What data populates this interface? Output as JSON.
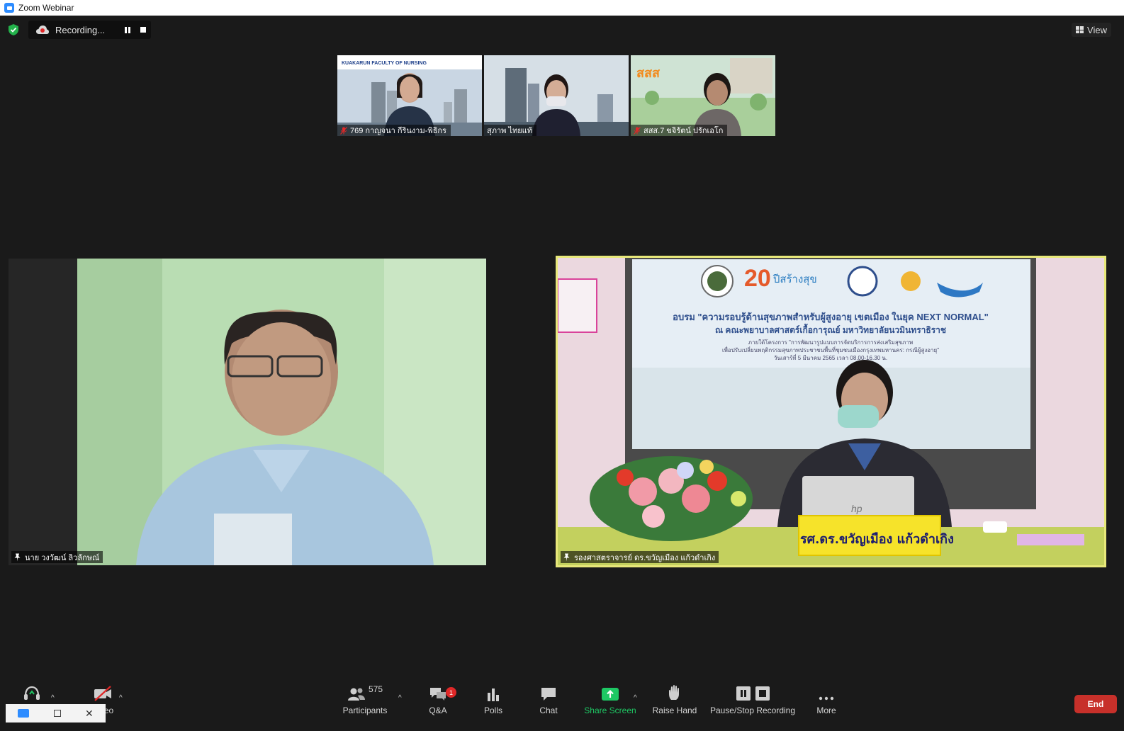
{
  "window": {
    "title": "Zoom Webinar"
  },
  "topbar": {
    "recording_text": "Recording...",
    "view_label": "View"
  },
  "thumbnails": [
    {
      "name": "769 กาญจนา กีรินงาม-พิธิกร",
      "muted": true,
      "banner": "KUAKARUN FACULTY OF NURSING"
    },
    {
      "name": "สุภาพ ไทยแท้",
      "muted": false
    },
    {
      "name": "สสส.7 ขจิรัตน์ ปรักเอโก",
      "muted": true,
      "banner": "สสส"
    }
  ],
  "main_videos": {
    "left": {
      "name": "นาย วงวัฒน์ ลิวลักษณ์"
    },
    "right": {
      "name": "รองศาสตราจารย์ ดร.ขวัญเมือง แก้วดำเกิง",
      "nameplate": "รศ.ดร.ขวัญเมือง  แก้วดำเกิง",
      "screen_title": "อบรม \"ความรอบรู้ด้านสุขภาพสำหรับผู้สูงอายุ เขตเมือง ในยุค NEXT NORMAL\"",
      "screen_subtitle": "ณ คณะพยาบาลศาสตร์เกื้อการุณย์ มหาวิทยาลัยนวมินทราธิราช",
      "screen_line1": "ภายใต้โครงการ \"การพัฒนารูปแบบการจัดบริการการส่งเสริมสุขภาพ",
      "screen_line2": "เพื่อปรับเปลี่ยนพฤติกรรมสุขภาพประชาชนพื้นที่ชุมชนเมืองกรุงเทพมหานคร: กรณีผู้สูงอายุ\"",
      "screen_line3": "วันเสาร์ที่ 5 มีนาคม 2565 เวลา 08.00-16.30 น.",
      "badge_20": "20",
      "badge_20_sub": "ปีสร้างสุข",
      "laptop_logo": "hp"
    }
  },
  "toolbar": {
    "audio_label": "",
    "video_label": "Video",
    "participants_label": "Participants",
    "participants_count": "575",
    "qa_label": "Q&A",
    "qa_badge": "1",
    "polls_label": "Polls",
    "chat_label": "Chat",
    "share_label": "Share Screen",
    "raise_label": "Raise Hand",
    "record_label": "Pause/Stop Recording",
    "more_label": "More",
    "end_label": "End"
  },
  "colors": {
    "share_green": "#1ec864",
    "end_red": "#c7302a",
    "active_speaker": "#e8e87a",
    "background": "#1a1a1a"
  }
}
